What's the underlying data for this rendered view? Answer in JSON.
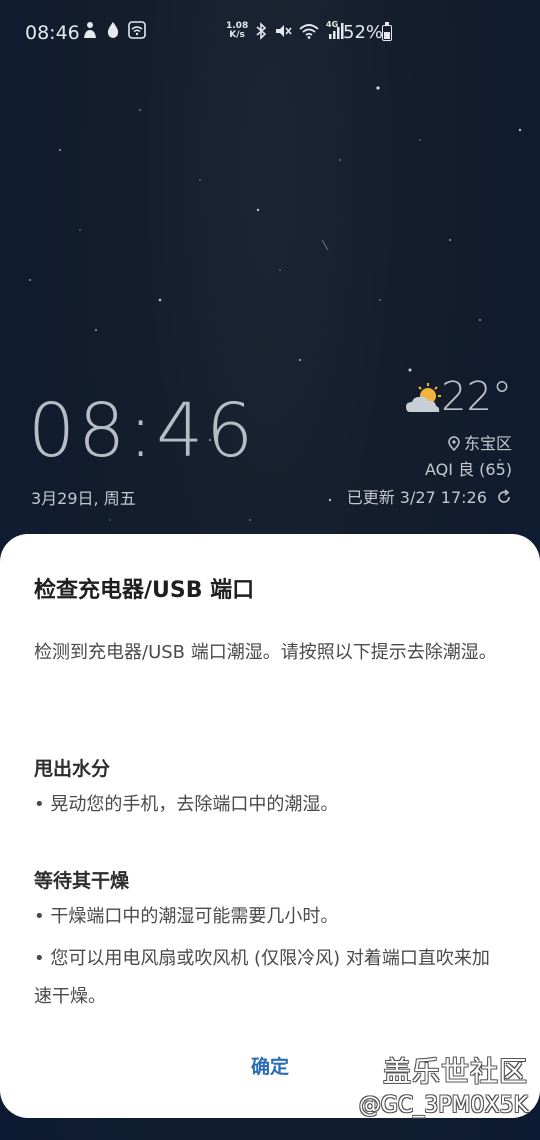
{
  "status_bar": {
    "time": "08:46",
    "net_speed_value": "1.08",
    "net_speed_unit": "K/s",
    "network_label": "4G",
    "battery_percent": "52%",
    "battery_level": 0.52,
    "left_icons": [
      "person-notification-icon",
      "water-drop-icon",
      "wifi-box-icon"
    ],
    "right_icons": [
      "bluetooth-icon",
      "mute-vibrate-icon",
      "wifi-icon",
      "signal-4g-icon",
      "battery-icon"
    ]
  },
  "lockscreen": {
    "clock": "08:46",
    "date": "3月29日, 周五"
  },
  "weather": {
    "temperature": "22°",
    "condition_icon": "partly-cloudy-icon",
    "location": "东宝区",
    "aqi": "AQI 良 (65)",
    "updated": "已更新 3/27 17:26"
  },
  "dialog": {
    "title": "检查充电器/USB 端口",
    "message": "检测到充电器/USB 端口潮湿。请按照以下提示去除潮湿。",
    "section1_heading": "甩出水分",
    "section1_item1": "• 晃动您的手机，去除端口中的潮湿。",
    "section2_heading": "等待其干燥",
    "section2_item1": "• 干燥端口中的潮湿可能需要几小时。",
    "section2_item2": "• 您可以用电风扇或吹风机 (仅限冷风) 对着端口直吹来加速干燥。",
    "ok_button": "确定"
  },
  "watermark": {
    "line1": "盖乐世社区",
    "line2": "@GC_3PM0X5K"
  },
  "colors": {
    "dialog_bg": "#ffffff",
    "button_accent": "#2b6db5"
  }
}
